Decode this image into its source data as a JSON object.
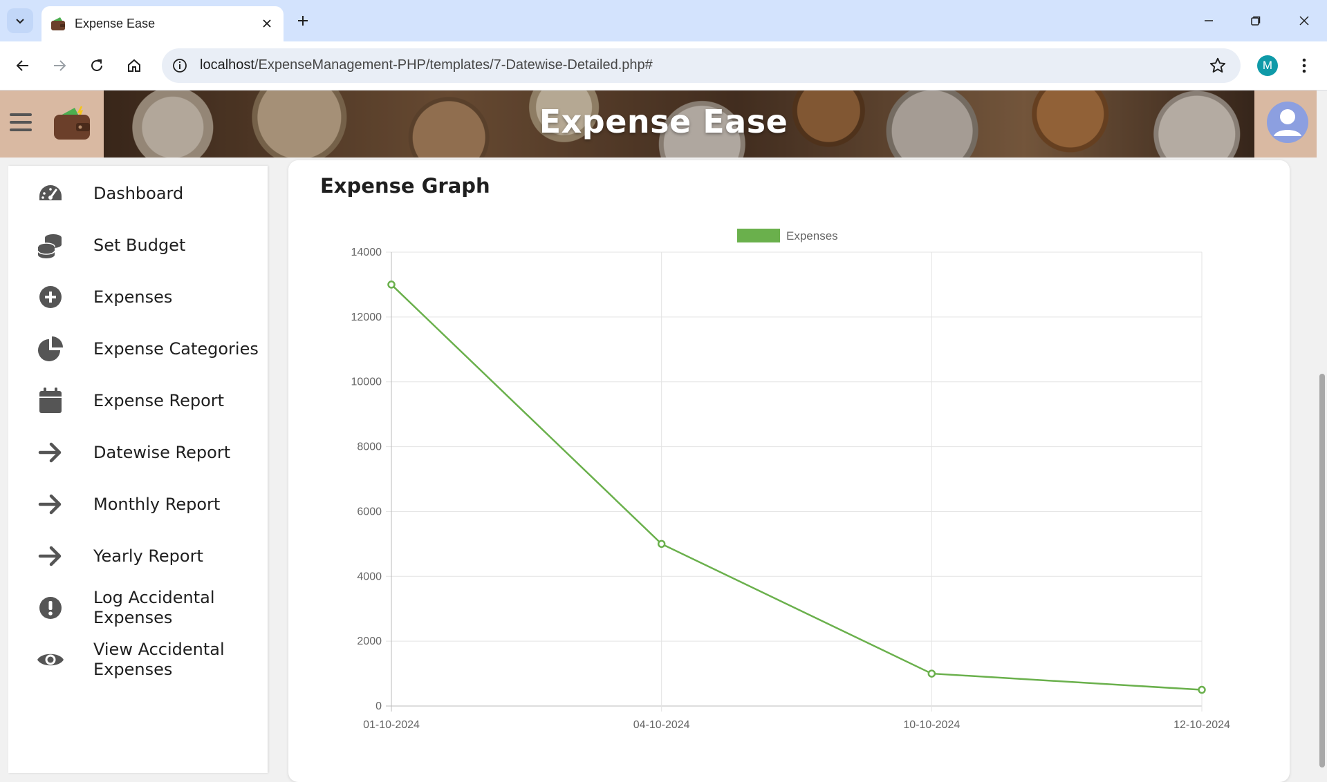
{
  "browser": {
    "tab_title": "Expense Ease",
    "url_host": "localhost",
    "url_path": "/ExpenseManagement-PHP/templates/7-Datewise-Detailed.php#",
    "profile_initial": "M"
  },
  "header": {
    "title": "Expense Ease"
  },
  "sidebar": {
    "items": [
      {
        "label": "Dashboard",
        "icon": "gauge-icon"
      },
      {
        "label": "Set Budget",
        "icon": "coins-icon"
      },
      {
        "label": "Expenses",
        "icon": "plus-circle-icon"
      },
      {
        "label": "Expense Categories",
        "icon": "pie-chart-icon"
      },
      {
        "label": "Expense Report",
        "icon": "calendar-icon"
      },
      {
        "label": "Datewise Report",
        "icon": "arrow-right-icon"
      },
      {
        "label": "Monthly Report",
        "icon": "arrow-right-icon"
      },
      {
        "label": "Yearly Report",
        "icon": "arrow-right-icon"
      },
      {
        "label": "Log Accidental Expenses",
        "icon": "exclamation-circle-icon"
      },
      {
        "label": "View Accidental Expenses",
        "icon": "eye-icon"
      }
    ]
  },
  "main": {
    "card_title": "Expense Graph"
  },
  "colors": {
    "series": "#6ab04c",
    "grid": "#e3e3e3",
    "axis_text": "#666666",
    "icon": "#555555"
  },
  "chart_data": {
    "type": "line",
    "categories": [
      "01-10-2024",
      "04-10-2024",
      "10-10-2024",
      "12-10-2024"
    ],
    "series": [
      {
        "name": "Expenses",
        "values": [
          13000,
          5000,
          1000,
          500
        ]
      }
    ],
    "y_ticks": [
      0,
      2000,
      4000,
      6000,
      8000,
      10000,
      12000,
      14000
    ],
    "ylim": [
      0,
      14000
    ],
    "legend": "top-center",
    "grid": true
  }
}
